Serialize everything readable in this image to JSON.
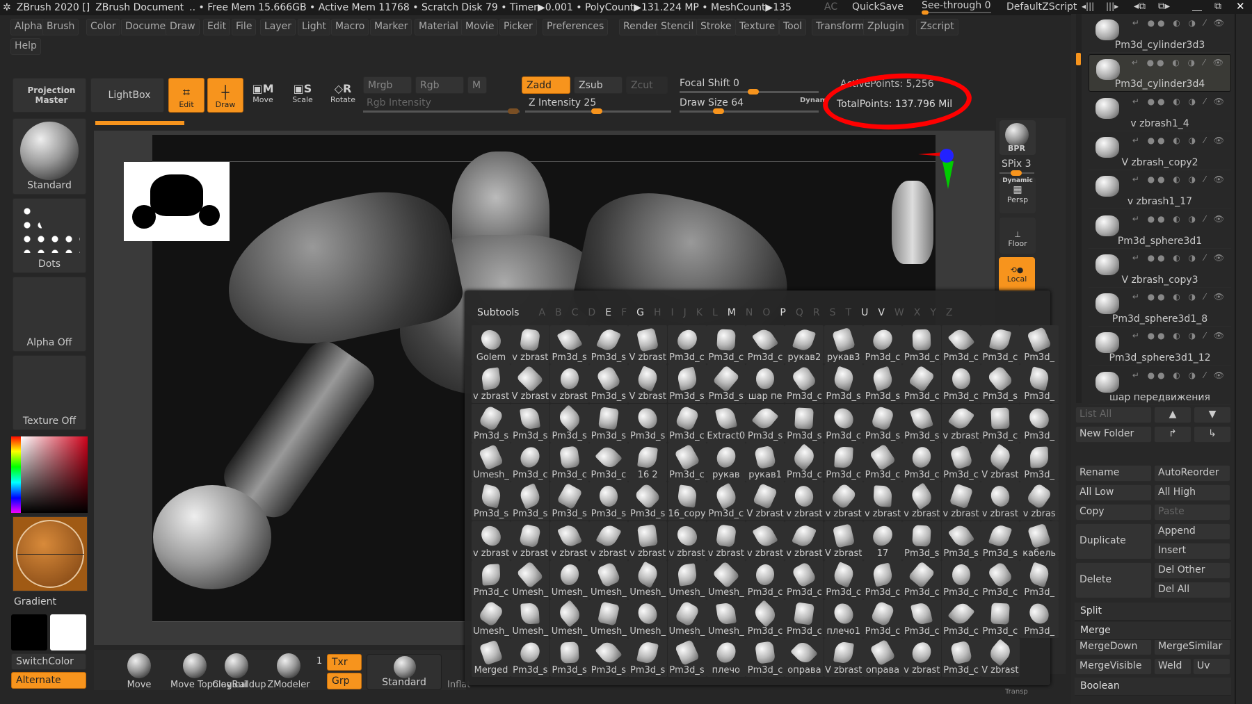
{
  "title": {
    "app": "ZBrush 2020 []",
    "doc": "ZBrush Document",
    "stats": ".. • Free Mem 15.666GB • Active Mem 11768 • Scratch Disk 79 • Timer▶0.001 • PolyCount▶131.224 MP • MeshCount▶135",
    "ac": "AC",
    "quicksave": "QuickSave",
    "seethrough": "See-through  0",
    "see_through_value": 0,
    "script": "DefaultZScript"
  },
  "menu": [
    "Alpha",
    "Brush",
    "Color",
    "Document",
    "Draw",
    "Edit",
    "File",
    "Layer",
    "Light",
    "Macro",
    "Marker",
    "Material",
    "Movie",
    "Picker",
    "Preferences",
    "Render",
    "Stencil",
    "Stroke",
    "Texture",
    "Tool",
    "Transform",
    "Zplugin",
    "Zscript",
    "Help"
  ],
  "toolbar": {
    "projection_master": "Projection Master",
    "lightbox": "LightBox",
    "edit": "Edit",
    "draw": "Draw",
    "move": "Move",
    "scale": "Scale",
    "rotate": "Rotate",
    "mrgb": "Mrgb",
    "rgb": "Rgb",
    "m": "M",
    "rgb_intensity": "Rgb Intensity",
    "zadd": "Zadd",
    "zsub": "Zsub",
    "zcut": "Zcut",
    "z_intensity": "Z Intensity 25",
    "focal_shift": "Focal Shift 0",
    "draw_size": "Draw Size 64",
    "dynamic": "Dynam",
    "active_points": "ActivePoints: 5,256",
    "total_points": "TotalPoints: 137.796 Mil",
    "z_intensity_value": 25,
    "focal_shift_value": 0,
    "draw_size_value": 64,
    "annotation_color": "#ff0000"
  },
  "left": {
    "brush": "Standard",
    "stroke": "Dots",
    "alpha": "Alpha Off",
    "texture": "Texture Off",
    "gradient": "Gradient",
    "switchcolor": "SwitchColor",
    "alternate": "Alternate",
    "main_color": "#000000",
    "secondary_color": "#ffffff"
  },
  "shelf": {
    "bpr": "BPR",
    "spix": "SPix 3",
    "persp": "Persp",
    "dynamic": "Dynamic",
    "floor": "Floor",
    "local": "Local",
    "transp": "Transp"
  },
  "bottom": {
    "brushes": [
      "Move",
      "Move Topological",
      "ClayBuildup",
      "ZModeler"
    ],
    "count": "1",
    "txr": "Txr",
    "grp": "Grp",
    "current": "Standard",
    "inflat": "Inflat"
  },
  "subtools_popup": {
    "title": "Subtools",
    "letters": [
      "A",
      "B",
      "C",
      "D",
      "E",
      "F",
      "G",
      "H",
      "I",
      "J",
      "K",
      "L",
      "M",
      "N",
      "O",
      "P",
      "Q",
      "R",
      "S",
      "T",
      "U",
      "V",
      "W",
      "X",
      "Y",
      "Z"
    ],
    "active_letters": [
      "E",
      "G",
      "M",
      "P",
      "U",
      "V"
    ],
    "rows": [
      [
        "Golem",
        "v zbrast",
        "Pm3d_s",
        "Pm3d_s",
        "V zbrast",
        "Pm3d_c",
        "Pm3d_c",
        "Pm3d_c",
        "рукав2",
        "рукав3",
        "Pm3d_c",
        "Pm3d_c",
        "Pm3d_c",
        "Pm3d_c",
        "Pm3d_"
      ],
      [
        "v zbrast",
        "V zbrast",
        "v zbrast",
        "Pm3d_s",
        "V zbrast",
        "Pm3d_s",
        "Pm3d_s",
        "шар пе",
        "Pm3d_c",
        "Pm3d_s",
        "Pm3d_s",
        "Pm3d_c",
        "Pm3d_c",
        "Pm3d_s",
        "Pm3d_"
      ],
      [
        "Pm3d_s",
        "Pm3d_s",
        "Pm3d_s",
        "Pm3d_s",
        "Pm3d_s",
        "Pm3d_c",
        "Extract0",
        "Pm3d_s",
        "Pm3d_s",
        "Pm3d_c",
        "Pm3d_s",
        "Pm3d_s",
        "v zbrast",
        "Pm3d_c",
        "Pm3d_"
      ],
      [
        "Umesh_",
        "Pm3d_c",
        "Pm3d_c",
        "Pm3d_c",
        "16 2",
        "Pm3d_c",
        "рукав",
        "рукав1",
        "Pm3d_c",
        "Pm3d_c",
        "Pm3d_c",
        "Pm3d_c",
        "Pm3d_c",
        "V zbrast",
        "Pm3d_"
      ],
      [
        "Pm3d_s",
        "Pm3d_s",
        "Pm3d_s",
        "Pm3d_s",
        "Pm3d_s",
        "16_copy",
        "Pm3d_c",
        "V zbrast",
        "v zbrast",
        "v zbrast",
        "v zbrast",
        "v zbrast",
        "v zbrast",
        "v zbrast",
        "v zbras"
      ],
      [
        "v zbrast",
        "v zbrast",
        "v zbrast",
        "v zbrast",
        "v zbrast",
        "v zbrast",
        "v zbrast",
        "v zbrast",
        "v zbrast",
        "V zbrast",
        "17",
        "Pm3d_s",
        "Pm3d_s",
        "Pm3d_s",
        "кабель"
      ],
      [
        "Pm3d_c",
        "Umesh_",
        "Umesh_",
        "Umesh_",
        "Umesh_",
        "Umesh_",
        "Umesh_",
        "Pm3d_c",
        "Pm3d_c",
        "Pm3d_c",
        "Pm3d_c",
        "Pm3d_c",
        "Pm3d_c",
        "Pm3d_c",
        "Pm3d_"
      ],
      [
        "Umesh_",
        "Umesh_",
        "Umesh_",
        "Umesh_",
        "Umesh_",
        "Umesh_",
        "Umesh_",
        "Pm3d_c",
        "Pm3d_c",
        "плечо1",
        "Pm3d_c",
        "Pm3d_c",
        "Pm3d_c",
        "Pm3d_c",
        "Pm3d_"
      ],
      [
        "Merged",
        "Pm3d_s",
        "Pm3d_s",
        "Pm3d_s",
        "Pm3d_s",
        "Pm3d_s",
        "плечо",
        "Pm3d_c",
        "оправа",
        "V zbrast",
        "оправа",
        "v zbrast",
        "Pm3d_c",
        "V zbrast"
      ]
    ]
  },
  "subtool_list": {
    "items": [
      "Pm3d_cylinder3d3",
      "Pm3d_cylinder3d4",
      "v zbrash1_4",
      "V zbrash_copy2",
      "v zbrash1_17",
      "Pm3d_sphere3d1",
      "V zbrash_copy3",
      "Pm3d_sphere3d1_8",
      "Pm3d_sphere3d1_12",
      "шар передвижения"
    ],
    "selected": "Pm3d_cylinder3d4"
  },
  "subtool_buttons": {
    "list_all": "List All",
    "new_folder": "New Folder",
    "rename": "Rename",
    "autoreorder": "AutoReorder",
    "all_low": "All Low",
    "all_high": "All High",
    "copy": "Copy",
    "paste": "Paste",
    "duplicate": "Duplicate",
    "append": "Append",
    "insert": "Insert",
    "delete": "Delete",
    "del_other": "Del Other",
    "del_all": "Del All",
    "split": "Split",
    "merge": "Merge",
    "mergedown": "MergeDown",
    "mergesimilar": "MergeSimilar",
    "mergevisible": "MergeVisible",
    "weld": "Weld",
    "uv": "Uv",
    "boolean": "Boolean"
  },
  "colors": {
    "accent": "#f7941d",
    "panel": "#333333",
    "background": "#262626"
  }
}
